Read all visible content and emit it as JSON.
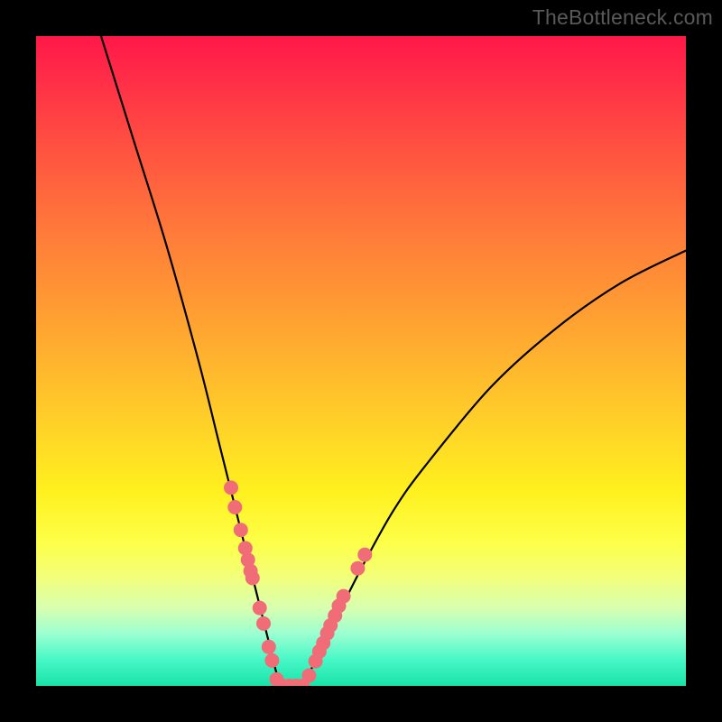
{
  "watermark": "TheBottleneck.com",
  "chart_data": {
    "type": "line",
    "title": "",
    "xlabel": "",
    "ylabel": "",
    "xlim": [
      0,
      100
    ],
    "ylim": [
      0,
      100
    ],
    "grid": false,
    "series": [
      {
        "name": "bottleneck-curve",
        "x": [
          10,
          15,
          20,
          25,
          28,
          30,
          32,
          34,
          35,
          36,
          37,
          38,
          40,
          42,
          45,
          50,
          55,
          60,
          70,
          80,
          90,
          100
        ],
        "y": [
          100,
          84,
          68,
          50,
          38,
          30,
          22,
          14,
          10,
          6,
          2,
          0,
          0,
          2,
          8,
          18,
          27,
          34,
          46,
          55,
          62,
          67
        ]
      }
    ],
    "markers": {
      "name": "highlight-dots",
      "x": [
        30.0,
        30.6,
        31.5,
        32.2,
        32.6,
        33.0,
        33.3,
        34.4,
        35.0,
        35.8,
        36.3,
        37.0,
        38.0,
        39.0,
        40.0,
        41.0,
        42.0,
        43.0,
        43.6,
        44.2,
        44.8,
        45.3,
        46.0,
        46.6,
        47.3,
        49.5,
        50.6
      ],
      "y": [
        30.5,
        27.5,
        24.0,
        21.2,
        19.4,
        17.7,
        16.6,
        12.0,
        9.6,
        6.0,
        3.9,
        1.0,
        0.0,
        0.0,
        0.0,
        0.0,
        1.6,
        3.8,
        5.3,
        6.6,
        8.1,
        9.3,
        10.8,
        12.3,
        13.8,
        18.1,
        20.2
      ]
    },
    "gradient_bands": [
      {
        "pos": 0,
        "color": "#ff1848"
      },
      {
        "pos": 18,
        "color": "#ff5440"
      },
      {
        "pos": 45,
        "color": "#ffa531"
      },
      {
        "pos": 70,
        "color": "#fff01f"
      },
      {
        "pos": 88,
        "color": "#d8ffb0"
      },
      {
        "pos": 100,
        "color": "#19e3a8"
      }
    ]
  }
}
